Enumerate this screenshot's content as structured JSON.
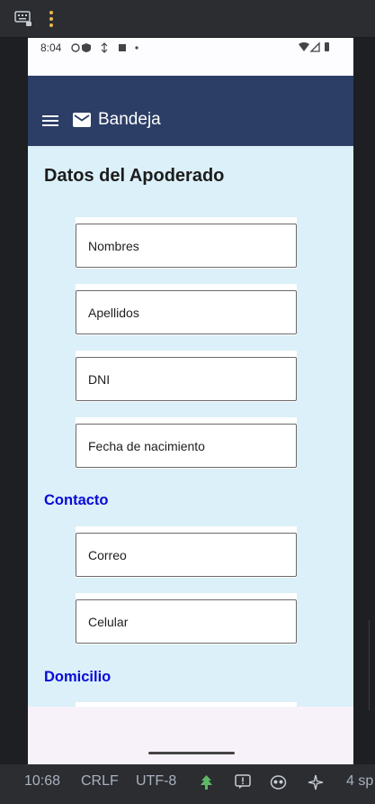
{
  "ide": {
    "toolbar": {
      "keyboard_icon": "keyboard-icon",
      "more_icon": "vertical-dots-icon"
    },
    "statusbar": {
      "position": "10:68",
      "line_ending": "CRLF",
      "encoding": "UTF-8",
      "indent": "4 sp"
    }
  },
  "device": {
    "status": {
      "time": "8:04"
    }
  },
  "app": {
    "appbar": {
      "title": "Bandeja"
    },
    "form": {
      "heading": "Datos del Apoderado",
      "fields_personal": [
        {
          "label": "Nombres"
        },
        {
          "label": "Apellidos"
        },
        {
          "label": "DNI"
        },
        {
          "label": "Fecha de nacimiento"
        }
      ],
      "section_contact": "Contacto",
      "fields_contact": [
        {
          "label": "Correo"
        },
        {
          "label": "Celular"
        }
      ],
      "section_address": "Domicilio"
    }
  },
  "colors": {
    "appbar": "#2c3e66",
    "content_bg": "#dbf0f8",
    "section_title": "#0a0ad8"
  }
}
